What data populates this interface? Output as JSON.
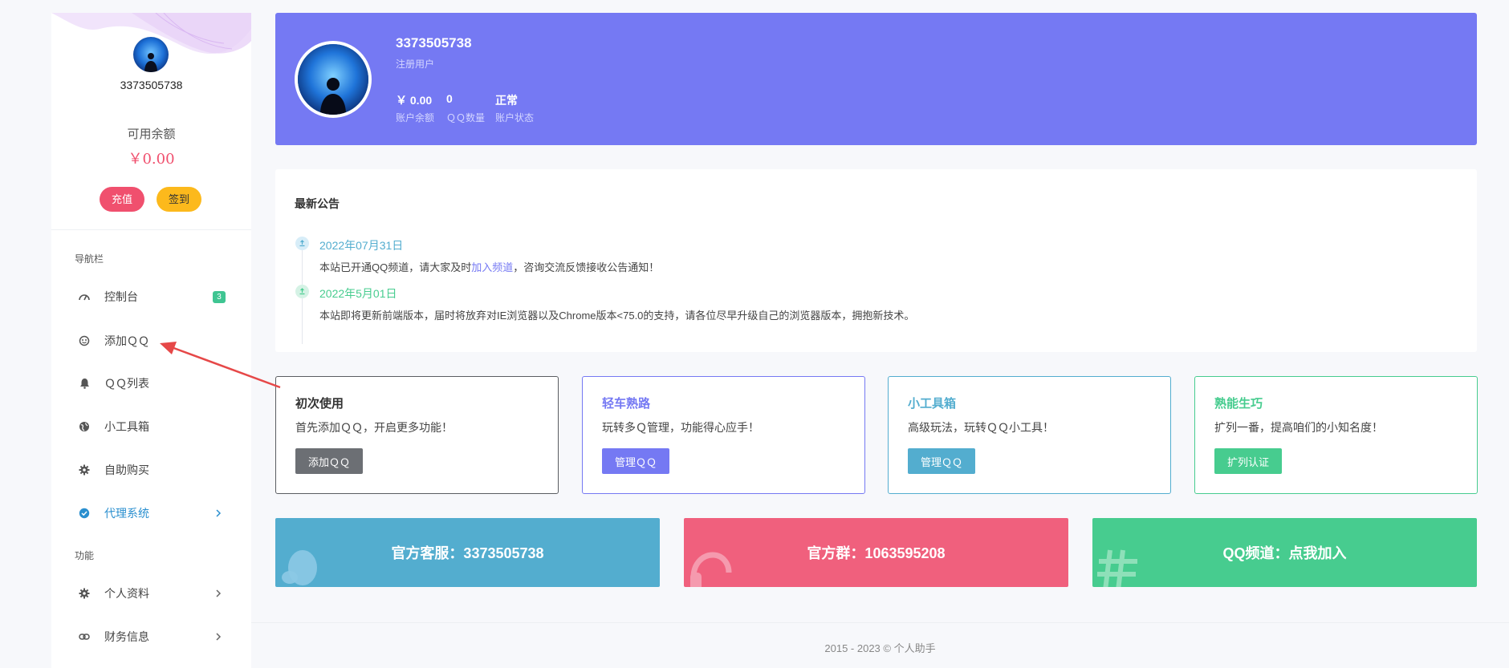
{
  "sidebar": {
    "username": "3373505738",
    "balance_label": "可用余额",
    "balance_value": "￥0.00",
    "recharge_label": "充值",
    "checkin_label": "签到",
    "nav_section_label": "导航栏",
    "func_section_label": "功能",
    "items": [
      {
        "label": "控制台",
        "icon": "dashboard-icon",
        "badge": "3"
      },
      {
        "label": "添加ＱＱ",
        "icon": "qq-icon"
      },
      {
        "label": "ＱＱ列表",
        "icon": "bell-icon"
      },
      {
        "label": "小工具箱",
        "icon": "globe-icon"
      },
      {
        "label": "自助购买",
        "icon": "gear-icon"
      },
      {
        "label": "代理系统",
        "icon": "verified-icon",
        "active": true
      },
      {
        "label": "个人资料",
        "icon": "gear-icon"
      },
      {
        "label": "财务信息",
        "icon": "link-icon"
      }
    ]
  },
  "hero": {
    "username": "3373505738",
    "role": "注册用户",
    "balance_value": "￥ 0.00",
    "balance_label": "账户余额",
    "qq_count_value": "0",
    "qq_count_label": "ＱＱ数量",
    "status_value": "正常",
    "status_label": "账户状态"
  },
  "notice": {
    "title": "最新公告",
    "items": [
      {
        "date": "2022年07月31日",
        "text_before": "本站已开通QQ频道，请大家及时",
        "link": "加入频道",
        "text_after": "，咨询交流反馈接收公告通知！"
      },
      {
        "date": "2022年5月01日",
        "text": "本站即将更新前端版本，届时将放弃对IE浏览器以及Chrome版本<75.0的支持，请各位尽早升级自己的浏览器版本，拥抱新技术。"
      }
    ]
  },
  "cards": [
    {
      "title": "初次使用",
      "desc": "首先添加ＱＱ，开启更多功能！",
      "button": "添加ＱＱ"
    },
    {
      "title": "轻车熟路",
      "desc": "玩转多Ｑ管理，功能得心应手！",
      "button": "管理ＱＱ"
    },
    {
      "title": "小工具箱",
      "desc": "高级玩法，玩转ＱＱ小工具！",
      "button": "管理ＱＱ"
    },
    {
      "title": "熟能生巧",
      "desc": "扩列一番，提高咱们的小知名度！",
      "button": "扩列认证"
    }
  ],
  "banners": [
    {
      "text": "官方客服：3373505738"
    },
    {
      "text": "官方群：1063595208"
    },
    {
      "text": "QQ频道：点我加入"
    }
  ],
  "footer": "2015 - 2023 © 个人助手",
  "colors": {
    "primary": "#7579f3",
    "danger": "#f0506e",
    "warning": "#fcb91c",
    "info": "#53adcf",
    "success": "#47cc8f",
    "dark": "#6c6f74"
  }
}
